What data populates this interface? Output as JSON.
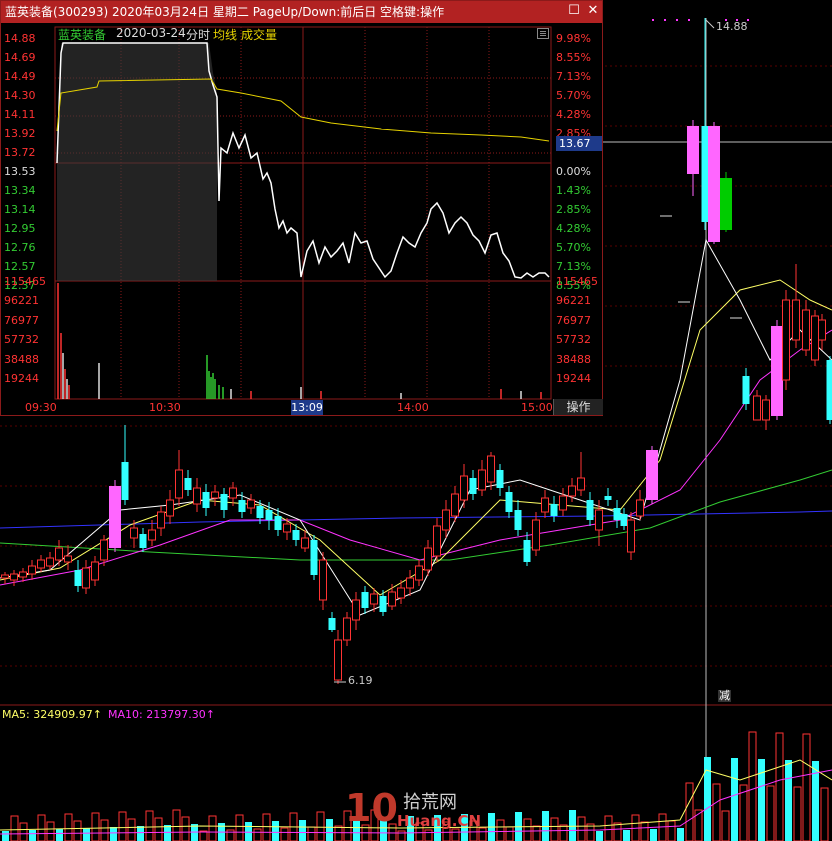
{
  "popup": {
    "title": "蓝英装备(300293) 2020年03月24日 星期二 PageUp/Down:前后日 空格键:操作",
    "minimize_icon": "minimize-icon",
    "close_icon": "close-icon",
    "legend": {
      "name": "蓝英装备",
      "date": "2020-03-24",
      "type": "分时",
      "avg_line": "均线",
      "volume": "成交量"
    },
    "price_labels_left": [
      "14.88",
      "14.69",
      "14.49",
      "14.30",
      "14.11",
      "13.92",
      "13.72",
      "13.53",
      "13.34",
      "13.14",
      "12.95",
      "12.76",
      "12.57",
      "12.37"
    ],
    "pct_labels_right": [
      "9.98%",
      "8.55%",
      "7.13%",
      "5.70%",
      "4.28%",
      "2.85%",
      "",
      "0.00%",
      "1.43%",
      "2.85%",
      "4.28%",
      "5.70%",
      "7.13%",
      "8.55%"
    ],
    "price_tag": "13.67",
    "volume_labels_left": [
      "115465",
      "96221",
      "76977",
      "57732",
      "38488",
      "19244"
    ],
    "volume_labels_right": [
      "115465",
      "96221",
      "76977",
      "57732",
      "38488",
      "19244"
    ],
    "time_labels": [
      "09:30",
      "10:30",
      "13:09",
      "14:00",
      "15:00"
    ],
    "selected_time": "13:09",
    "operate_tab": "操作",
    "colors": {
      "title_bg": "#b22222",
      "up": "#ff3333",
      "down": "#33cc33",
      "flat": "#ffffff",
      "avg": "#e6d200",
      "grid": "#8b1a1a",
      "time_sel": "#1e3a8a"
    }
  },
  "main_chart": {
    "high_label": "14.88",
    "low_label": "6.19",
    "reduce_badge": "减",
    "colors": {
      "up": "#ff3333",
      "down": "#33ffff",
      "limit_up": "#ff66ff",
      "ma5": "#ffffff",
      "ma10": "#ffff66",
      "ma20": "#ff33ff",
      "ma60": "#33cc33",
      "ma120": "#3333ff"
    }
  },
  "volume_panel": {
    "ma5_label": "MA5: 324909.97↑",
    "ma10_label": "MA10: 213797.30↑"
  },
  "watermark": {
    "text_top": "拾荒网",
    "text_bottom": "Huang.CN",
    "number": "10"
  },
  "chart_data": {
    "type": "line",
    "title": "",
    "x": [
      "09:30",
      "10:30",
      "13:09",
      "14:00",
      "15:00"
    ],
    "series": [
      {
        "name": "分时",
        "values": [
          13.53,
          14.88,
          14.88,
          13.72,
          12.95,
          12.76,
          12.37,
          12.4
        ]
      },
      {
        "name": "均线",
        "values": [
          13.53,
          14.49,
          14.3,
          14.3,
          14.11,
          13.92,
          13.85,
          13.75
        ]
      }
    ],
    "ylim": [
      12.37,
      14.88
    ]
  }
}
